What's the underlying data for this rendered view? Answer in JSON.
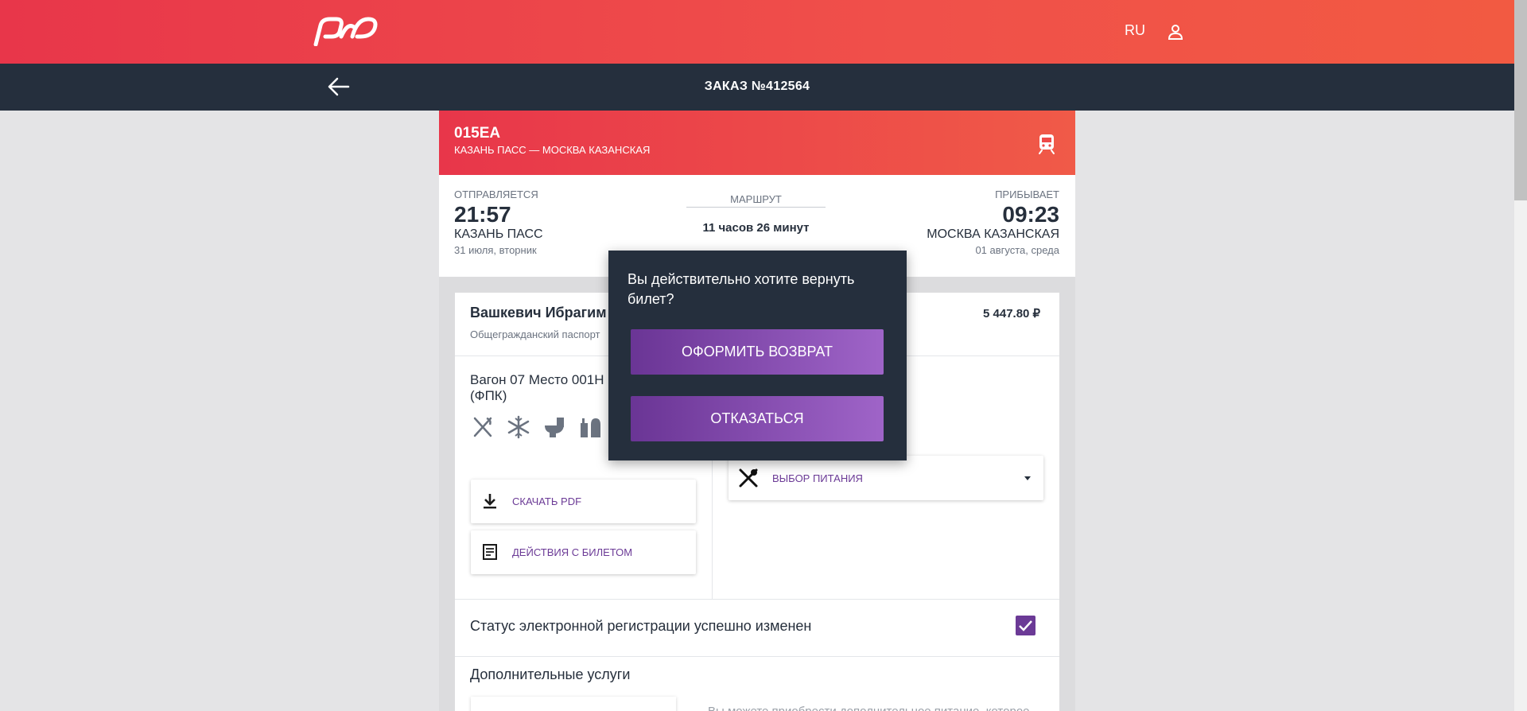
{
  "header": {
    "logo": "РЖД",
    "language": "RU",
    "user_icon": "user-icon"
  },
  "subheader": {
    "back_icon": "arrow-left-icon",
    "order_title": "ЗАКАЗ №412564"
  },
  "train": {
    "number": "015ЕА",
    "route": "КАЗАНЬ ПАСС — МОСКВА КАЗАНСКАЯ",
    "icon": "train-icon"
  },
  "schedule": {
    "departs_label": "ОТПРАВЛЯЕТСЯ",
    "departs_time": "21:57",
    "departs_station": "КАЗАНЬ ПАСС",
    "departs_date": "31 июля, вторник",
    "route_label": "МАРШРУТ",
    "duration": "11 часов 26 минут",
    "arrives_label": "ПРИБЫВАЕТ",
    "arrives_time": "09:23",
    "arrives_station": "МОСКВА КАЗАНСКАЯ",
    "arrives_date": "01 августа, среда"
  },
  "passenger": {
    "name": "Вашкевич Ибрагим",
    "document": "Общегражданский паспорт",
    "price": "5 447.80 ₽",
    "wagon": "Вагон 07 Место 001Н (ФПК)",
    "amenities": [
      "restaurant-icon",
      "air-conditioning-icon",
      "toilet-icon",
      "hygiene-icon"
    ]
  },
  "actions": {
    "download_pdf": "СКАЧАТЬ PDF",
    "ticket_actions": "ДЕЙСТВИЯ С БИЛЕТОМ",
    "meal_choice": "ВЫБОР ПИТАНИЯ"
  },
  "registration": {
    "status_text": "Статус электронной регистрации успешно изменен",
    "checked": true
  },
  "extras": {
    "title": "Дополнительные услуги",
    "note": "Вы можете приобрести дополнительное питание, которое"
  },
  "modal": {
    "question": "Вы действительно хотите вернуть билет?",
    "confirm": "ОФОРМИТЬ ВОЗВРАТ",
    "cancel": "ОТКАЗАТЬСЯ"
  },
  "colors": {
    "brand_red": "#e8364a",
    "dark_navy": "#252f3d",
    "accent_purple": "#6b3a96"
  }
}
